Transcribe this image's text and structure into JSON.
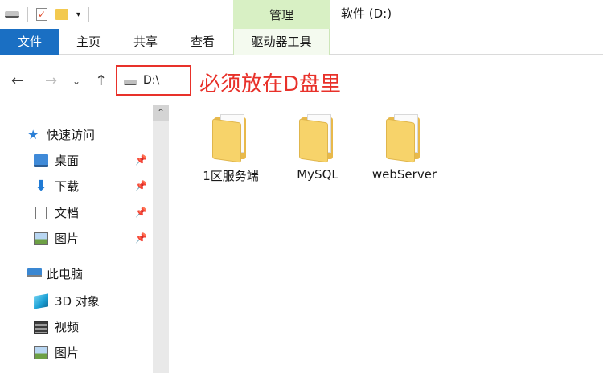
{
  "titlebar": {
    "manage_tab": "管理",
    "window_title": "软件 (D:)"
  },
  "ribbon": {
    "tabs": [
      {
        "label": "文件"
      },
      {
        "label": "主页"
      },
      {
        "label": "共享"
      },
      {
        "label": "查看"
      },
      {
        "label": "驱动器工具"
      }
    ]
  },
  "address": {
    "path": "D:\\",
    "annotation": "必须放在D盘里",
    "annotation_color": "#e8312a"
  },
  "sidebar": {
    "quick_access": "快速访问",
    "pinned_items": [
      {
        "label": "桌面",
        "icon": "desktop-icon"
      },
      {
        "label": "下载",
        "icon": "download-icon"
      },
      {
        "label": "文档",
        "icon": "document-icon"
      },
      {
        "label": "图片",
        "icon": "pictures-icon"
      }
    ],
    "this_pc": "此电脑",
    "pc_items": [
      {
        "label": "3D 对象",
        "icon": "3d-objects-icon"
      },
      {
        "label": "视频",
        "icon": "video-icon"
      },
      {
        "label": "图片",
        "icon": "pictures-icon"
      }
    ]
  },
  "files": [
    {
      "name": "1区服务端",
      "icon": "folder-icon"
    },
    {
      "name": "MySQL",
      "icon": "folder-icon"
    },
    {
      "name": "webServer",
      "icon": "folder-icon"
    }
  ],
  "colors": {
    "accent": "#1a6fc3",
    "manage_tab": "#d8f0c4",
    "folder": "#f7d36a"
  }
}
